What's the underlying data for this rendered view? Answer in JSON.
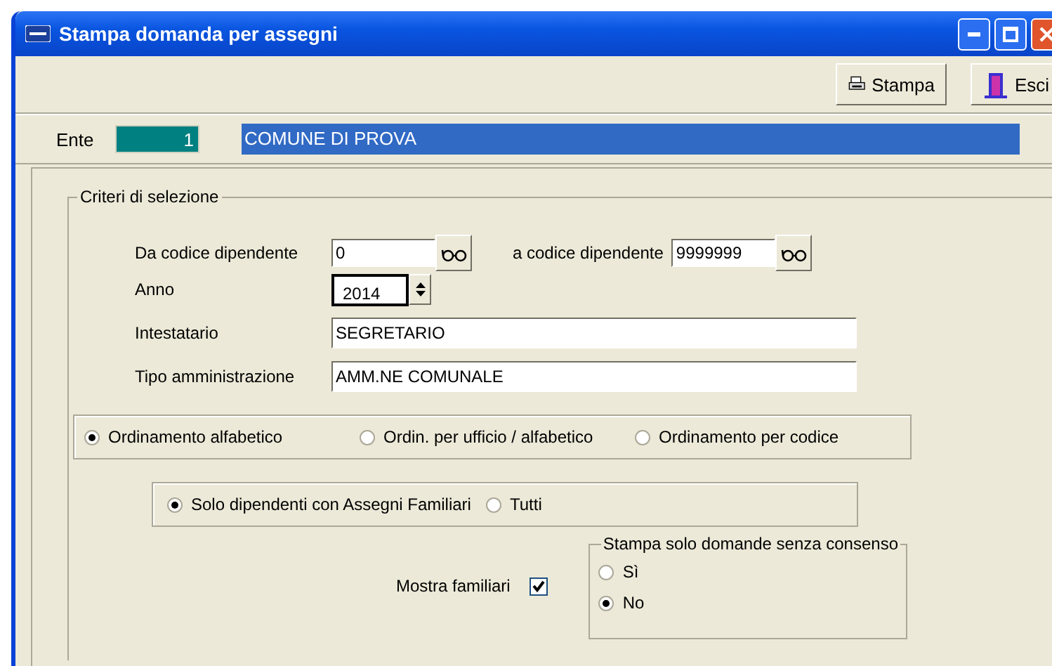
{
  "window": {
    "title": "Stampa domanda per assegni"
  },
  "toolbar": {
    "buttons": [
      {
        "label": "Stampa",
        "kind": "print"
      },
      {
        "label": "Esci",
        "kind": "exit"
      }
    ]
  },
  "ente": {
    "label": "Ente",
    "code": "1",
    "name": "COMUNE DI PROVA"
  },
  "criteria": {
    "title": "Criteri di selezione",
    "from_code": {
      "label": "Da codice dipendente",
      "value": "0"
    },
    "to_code": {
      "label": "a codice dipendente",
      "value": "9999999"
    },
    "year": {
      "label": "Anno",
      "value": "2014"
    },
    "holder": {
      "label": "Intestatario",
      "value": "SEGRETARIO"
    },
    "admin_type": {
      "label": "Tipo amministrazione",
      "value": "AMM.NE COMUNALE"
    },
    "ordering": [
      {
        "label": "Ordinamento alfabetico",
        "selected": true
      },
      {
        "label": "Ordin. per ufficio / alfabetico",
        "selected": false
      },
      {
        "label": "Ordinamento per codice",
        "selected": false
      }
    ],
    "employees": [
      {
        "label": "Solo dipendenti con Assegni Familiari",
        "selected": true
      },
      {
        "label": "Tutti",
        "selected": false
      }
    ],
    "show_family": {
      "label": "Mostra familiari",
      "checked": true
    },
    "consent": {
      "title": "Stampa solo domande senza consenso",
      "options": [
        {
          "label": "Sì",
          "selected": false
        },
        {
          "label": "No",
          "selected": true
        }
      ]
    }
  }
}
